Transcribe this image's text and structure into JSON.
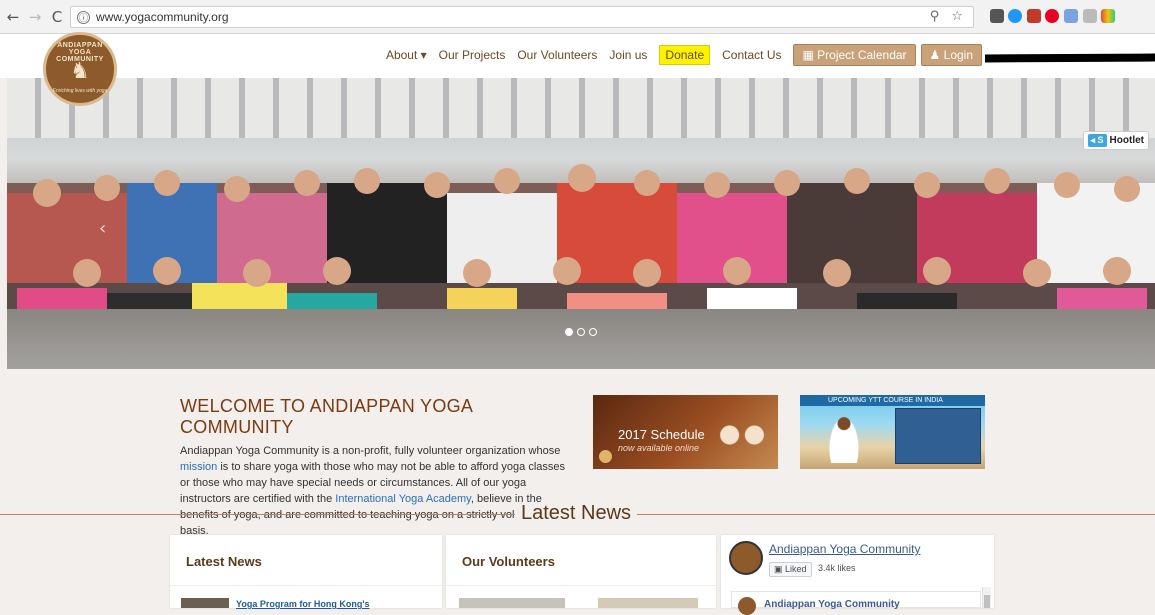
{
  "browser": {
    "back": "←",
    "forward": "→",
    "reload": "C",
    "info": "ⓘ",
    "url": "www.yogacommunity.org",
    "right_icons": "⚲ ☆"
  },
  "logo": {
    "ring_text": "ANDIAPPAN YOGA COMMUNITY",
    "figure": "♞",
    "tagline": "Enriching lives with yoga"
  },
  "menu": {
    "about": "About ▾",
    "projects": "Our Projects",
    "volunteers": "Our Volunteers",
    "join": "Join us",
    "donate": "Donate",
    "contact": "Contact Us",
    "calendar": "▦ Project Calendar",
    "login": "♟ Login"
  },
  "hero": {
    "caret": "‹",
    "hootlet_send": "◂ S",
    "hootlet": "Hootlet"
  },
  "welcome": {
    "title": "WELCOME TO ANDIAPPAN YOGA COMMUNITY",
    "p1": "Andiappan Yoga Community is a non-profit, fully volunteer organization whose ",
    "mission": "mission",
    "p2": " is to share yoga with those who may not be able to afford yoga classes or those who may have special needs or circumstances. All of our yoga instructors are certified with the ",
    "academy": "International Yoga Academy",
    "p3": ", believe in the benefits of yoga, and are committed to teaching yoga on a strictly volunteer basis."
  },
  "banners": {
    "schedule": "2017 Schedule",
    "schedule_sub": "now available online",
    "ytt": "UPCOMING YTT COURSE IN INDIA"
  },
  "latest_news_heading": "Latest News",
  "cards": {
    "news_title": "Latest News",
    "news_item": "Yoga Program for Hong Kong's",
    "volunteers_title": "Our Volunteers",
    "fb_name": "Andiappan Yoga Community",
    "fb_liked": "▣ Liked",
    "fb_likes": "3.4k likes",
    "fb_post_name": "Andiappan Yoga Community"
  }
}
